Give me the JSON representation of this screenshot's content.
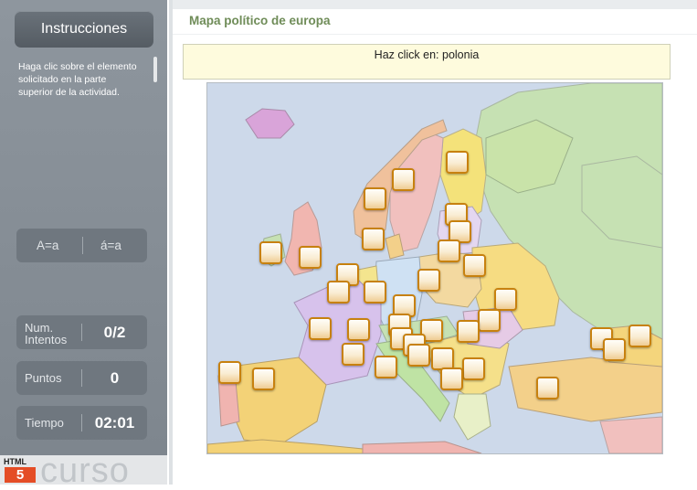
{
  "sidebar": {
    "instructions_button": "Instrucciones",
    "instructions_text": "Haga clic sobre el elemento solicitado en la parte superior de la actividad.",
    "case_upper": "A=a",
    "case_accent": "á=a",
    "stats": [
      {
        "label": "Num. Intentos",
        "value": "0/2"
      },
      {
        "label": "Puntos",
        "value": "0"
      },
      {
        "label": "Tiempo",
        "value": "02:01"
      }
    ],
    "logo_html": "HTML",
    "logo_five": "5",
    "logo_word": "curso"
  },
  "main": {
    "title": "Mapa político de europa",
    "prompt": "Haz click en: polonia"
  },
  "colors": {
    "sea": "#cdd9ea",
    "accent_title": "#6f8c58",
    "marker_border": "#c7810f",
    "prompt_bg": "#fefbdd"
  },
  "icons": [
    "country-marker-icon",
    "html5-logo-icon"
  ]
}
